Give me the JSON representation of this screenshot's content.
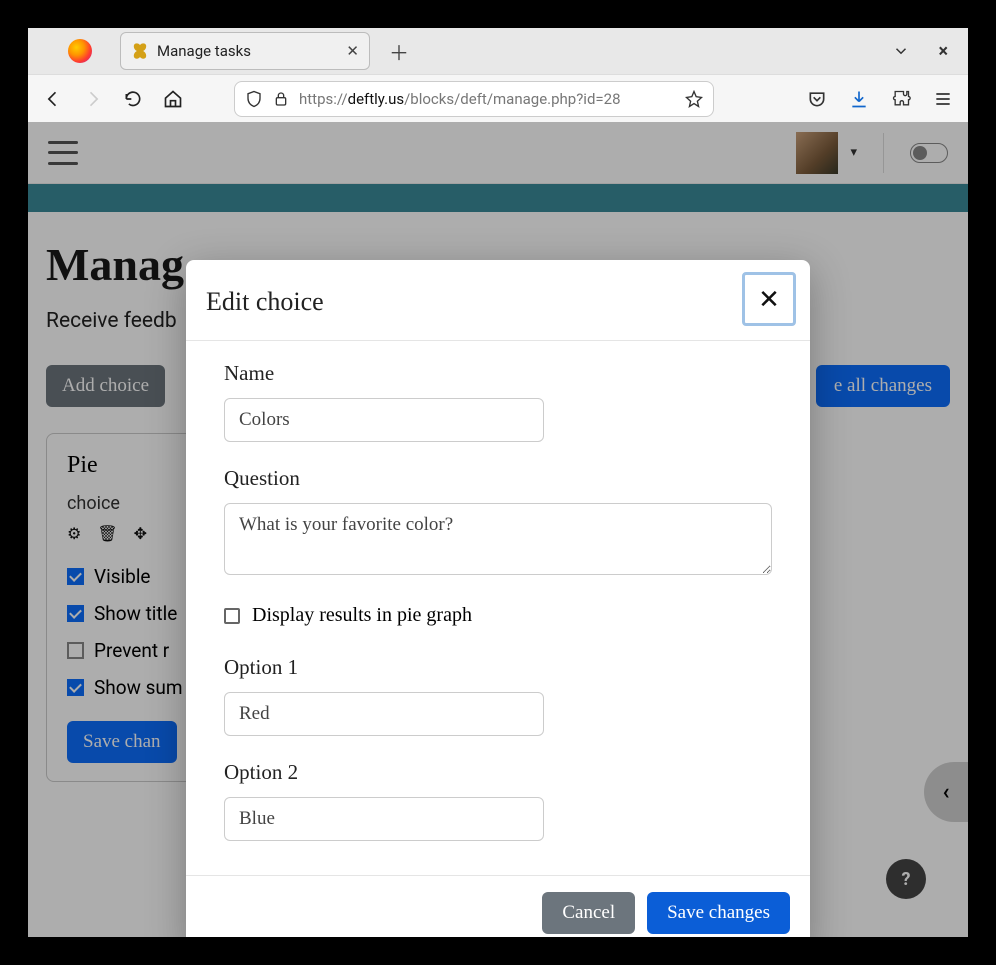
{
  "browser": {
    "tab_title": "Manage tasks",
    "url_prefix": "https://",
    "url_host": "deftly.us",
    "url_path": "/blocks/deft/manage.php?id=28"
  },
  "page": {
    "title": "Manag",
    "subtitle": "Receive feedb",
    "add_choice": "Add choice",
    "save_all": "e all changes"
  },
  "card": {
    "title": "Pie",
    "type": "choice",
    "chk_visible": "Visible",
    "chk_showtitle": "Show title",
    "chk_prevent": "Prevent r",
    "chk_showsum": "Show sum",
    "save": "Save chan"
  },
  "modal": {
    "title": "Edit choice",
    "name_label": "Name",
    "name_value": "Colors",
    "question_label": "Question",
    "question_value": "What is your favorite color?",
    "piegraph_label": "Display results in pie graph",
    "option1_label": "Option 1",
    "option1_value": "Red",
    "option2_label": "Option 2",
    "option2_value": "Blue",
    "cancel": "Cancel",
    "save": "Save changes"
  }
}
